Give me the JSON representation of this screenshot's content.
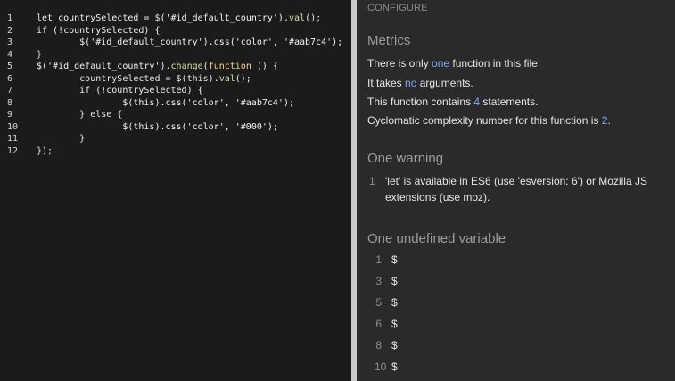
{
  "code": {
    "lines": [
      {
        "num": "1",
        "segments": [
          {
            "text": "let countrySelected = ",
            "cls": "tok-keyword"
          },
          {
            "text": "$",
            "cls": "tok-plain"
          },
          {
            "text": "('#id_default_country')",
            "cls": "tok-string"
          },
          {
            "text": ".",
            "cls": "tok-plain"
          },
          {
            "text": "val",
            "cls": "tok-function"
          },
          {
            "text": "();",
            "cls": "tok-plain"
          }
        ]
      },
      {
        "num": "2",
        "segments": [
          {
            "text": "if (!countrySelected) {",
            "cls": "tok-keyword"
          }
        ]
      },
      {
        "num": "3",
        "segments": [
          {
            "text": "        $('#id_default_country').css('color', '#aab7c4');",
            "cls": "tok-string"
          }
        ]
      },
      {
        "num": "4",
        "segments": [
          {
            "text": "}",
            "cls": "tok-plain"
          }
        ]
      },
      {
        "num": "5",
        "segments": [
          {
            "text": "$('#id_default_country')",
            "cls": "tok-string"
          },
          {
            "text": ".",
            "cls": "tok-plain"
          },
          {
            "text": "change",
            "cls": "tok-function"
          },
          {
            "text": "(",
            "cls": "tok-plain"
          },
          {
            "text": "function",
            "cls": "tok-fn2"
          },
          {
            "text": " () {",
            "cls": "tok-plain"
          }
        ]
      },
      {
        "num": "6",
        "segments": [
          {
            "text": "        countrySelected = $(this).",
            "cls": "tok-plain"
          },
          {
            "text": "val",
            "cls": "tok-function"
          },
          {
            "text": "();",
            "cls": "tok-plain"
          }
        ]
      },
      {
        "num": "7",
        "segments": [
          {
            "text": "        if (!countrySelected) {",
            "cls": "tok-keyword"
          }
        ]
      },
      {
        "num": "8",
        "segments": [
          {
            "text": "                $(this).css('color', '#aab7c4');",
            "cls": "tok-string"
          }
        ]
      },
      {
        "num": "9",
        "segments": [
          {
            "text": "        } else {",
            "cls": "tok-plain"
          }
        ]
      },
      {
        "num": "10",
        "segments": [
          {
            "text": "                $(this).css('color', '#000');",
            "cls": "tok-string"
          }
        ]
      },
      {
        "num": "11",
        "segments": [
          {
            "text": "        }",
            "cls": "tok-plain"
          }
        ]
      },
      {
        "num": "12",
        "segments": [
          {
            "text": "});",
            "cls": "tok-plain"
          }
        ]
      }
    ]
  },
  "report": {
    "configure_label": "CONFIGURE",
    "metrics_title": "Metrics",
    "metrics": {
      "line1_prefix": "There is only ",
      "line1_value": "one",
      "line1_suffix": " function in this file.",
      "line2_prefix": "It takes ",
      "line2_value": "no",
      "line2_suffix": " arguments.",
      "line3_prefix": "This function contains ",
      "line3_value": "4",
      "line3_suffix": " statements.",
      "line4_prefix": "Cyclomatic complexity number for this function is ",
      "line4_value": "2",
      "line4_suffix": "."
    },
    "warning_title": "One warning",
    "warning": {
      "num": "1",
      "text": "'let' is available in ES6 (use 'esversion: 6') or Mozilla JS extensions (use moz)."
    },
    "undefined_title": "One undefined variable",
    "undefined_vars": [
      {
        "num": "1",
        "name": "$"
      },
      {
        "num": "3",
        "name": "$"
      },
      {
        "num": "5",
        "name": "$"
      },
      {
        "num": "6",
        "name": "$"
      },
      {
        "num": "8",
        "name": "$"
      },
      {
        "num": "10",
        "name": "$"
      }
    ]
  },
  "colors": {
    "editor_bg": "#1b1b1b",
    "report_bg": "#2a2a2a",
    "divider": "#c9c9c9",
    "highlight": "#7aa9ff"
  }
}
